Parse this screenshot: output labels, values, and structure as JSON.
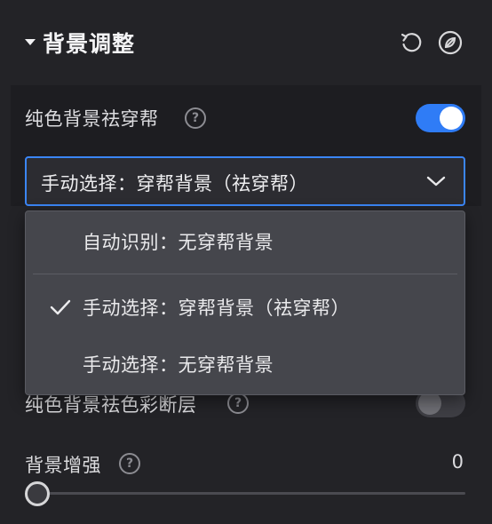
{
  "panel": {
    "title": "背景调整",
    "reset_icon": "reset-icon",
    "erase_icon": "eraser-icon"
  },
  "remove_bg": {
    "label": "纯色背景祛穿帮",
    "help": "?",
    "enabled": true
  },
  "select": {
    "value": "手动选择：穿帮背景（祛穿帮）",
    "options": [
      {
        "label": "自动识别：无穿帮背景",
        "checked": false
      },
      {
        "label": "手动选择：穿帮背景（祛穿帮）",
        "checked": true
      },
      {
        "label": "手动选择：无穿帮背景",
        "checked": false
      }
    ]
  },
  "color_layer": {
    "label": "纯色背景祛色彩断层",
    "help": "?",
    "enabled": false
  },
  "enhance": {
    "label": "背景增强",
    "help": "?",
    "value": "0"
  },
  "colors": {
    "accent": "#2f7cf6",
    "background": "#232327",
    "dropdown": "#45464c"
  }
}
